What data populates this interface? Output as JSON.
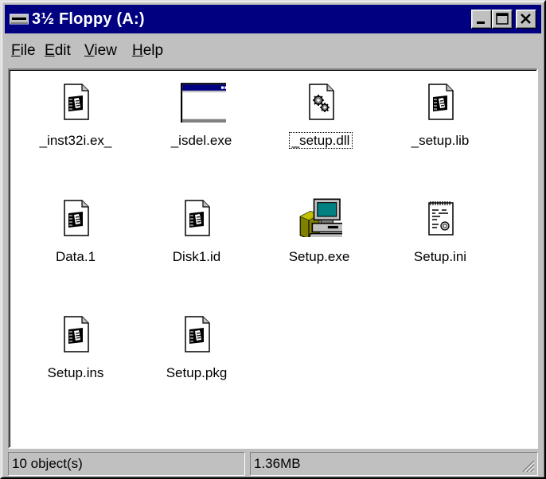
{
  "window": {
    "title": "3½ Floppy (A:)",
    "title_icon": "floppy-drive-icon",
    "controls": [
      "minimize",
      "maximize",
      "close"
    ]
  },
  "menu": {
    "items": [
      {
        "label": "File",
        "accel": "F",
        "rest": "ile"
      },
      {
        "label": "Edit",
        "accel": "E",
        "rest": "dit"
      },
      {
        "label": "View",
        "accel": "V",
        "rest": "iew"
      },
      {
        "label": "Help",
        "accel": "H",
        "rest": "elp"
      }
    ]
  },
  "files": [
    {
      "name": "_inst32i.ex_",
      "icon": "installshield-file-icon"
    },
    {
      "name": "_isdel.exe",
      "icon": "application-window-icon"
    },
    {
      "name": "_setup.dll",
      "icon": "dll-gears-icon",
      "selected": true
    },
    {
      "name": "_setup.lib",
      "icon": "installshield-file-icon"
    },
    {
      "name": "Data.1",
      "icon": "installshield-file-icon"
    },
    {
      "name": "Disk1.id",
      "icon": "installshield-file-icon"
    },
    {
      "name": "Setup.exe",
      "icon": "setup-computer-icon"
    },
    {
      "name": "Setup.ini",
      "icon": "config-notepad-icon"
    },
    {
      "name": "Setup.ins",
      "icon": "installshield-file-icon"
    },
    {
      "name": "Setup.pkg",
      "icon": "installshield-file-icon"
    }
  ],
  "status": {
    "objects": "10 object(s)",
    "size": "1.36MB"
  },
  "colors": {
    "titlebar": "#000080",
    "face": "#c0c0c0",
    "content_bg": "#ffffff"
  }
}
